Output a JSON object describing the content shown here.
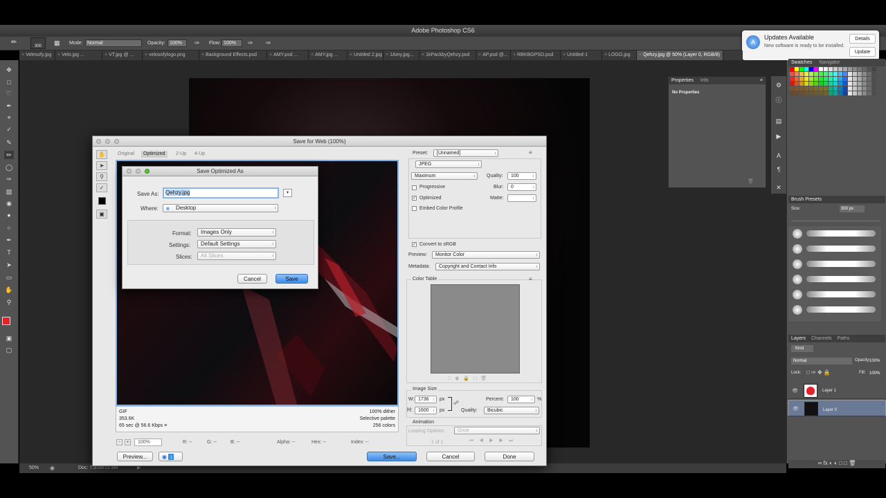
{
  "app": {
    "title": "Adobe Photoshop CS6"
  },
  "options_bar": {
    "brush_size": "300",
    "mode_label": "Mode:",
    "mode_value": "Normal",
    "opacity_label": "Opacity:",
    "opacity_value": "100%",
    "flow_label": "Flow:",
    "flow_value": "100%"
  },
  "doc_tabs": [
    "Velesofy.jpg",
    "Velo.jpg ...",
    "VT.jpg @ ...",
    "velosofylogo.png",
    "Background Effects.psd",
    "AMY.psd ...",
    "AMY.jpg ...",
    "Untitled 2.jpg",
    "1Amy.jpg...",
    "1kPackbyQehzy.psd",
    "AP.psd @...",
    "RBKBGPSD.psd",
    "Untitled-1",
    "LOGO.jpg",
    "Qehzy.jpg @ 50% (Layer 0, RGB/8)"
  ],
  "notification": {
    "title": "Updates Available",
    "body": "New software is ready to be installed.",
    "details_button": "Details",
    "update_button": "Update"
  },
  "properties_panel": {
    "tab_properties": "Properties",
    "tab_info": "Info",
    "content": "No Properties"
  },
  "swatches_panel": {
    "tab_swatches": "Swatches",
    "tab_navigator": "Navigator"
  },
  "brush_presets": {
    "title": "Brush Presets",
    "size_label": "Size:",
    "size_value": "300 px"
  },
  "layers_panel": {
    "tabs": [
      "Layers",
      "Channels",
      "Paths"
    ],
    "kind_label": "Kind",
    "blend_mode": "Normal",
    "opacity_label": "Opacity:",
    "opacity_value": "100%",
    "lock_label": "Lock:",
    "fill_label": "Fill:",
    "fill_value": "100%",
    "layers": [
      {
        "name": "Layer 1",
        "selected": false
      },
      {
        "name": "Layer 0",
        "selected": true
      }
    ]
  },
  "status_bar": {
    "zoom": "50%",
    "doc_info": "Doc: 7.91M/15.9M"
  },
  "save_for_web": {
    "title": "Save for Web (100%)",
    "view_tabs": [
      "Original",
      "Optimized",
      "2-Up",
      "4-Up"
    ],
    "active_tab": "Optimized",
    "preset_label": "Preset:",
    "preset_value": "[Unnamed]",
    "format_value": "JPEG",
    "compression_value": "Maximum",
    "quality_label": "Quality:",
    "quality_value": "100",
    "progressive_label": "Progressive",
    "progressive_checked": false,
    "blur_label": "Blur:",
    "blur_value": "0",
    "optimized_label": "Optimized",
    "optimized_checked": true,
    "matte_label": "Matte:",
    "embed_profile_label": "Embed Color Profile",
    "embed_profile_checked": false,
    "convert_srgb_label": "Convert to sRGB",
    "convert_srgb_checked": true,
    "preview_label": "Preview:",
    "preview_value": "Monitor Color",
    "metadata_label": "Metadata:",
    "metadata_value": "Copyright and Contact Info",
    "color_table_label": "Color Table",
    "image_size_label": "Image Size",
    "width_label": "W:",
    "width_value": "1736",
    "height_label": "H:",
    "height_value": "1600",
    "px_unit": "px",
    "percent_label": "Percent:",
    "percent_value": "100",
    "percent_unit": "%",
    "resample_quality_label": "Quality:",
    "resample_quality_value": "Bicubic",
    "animation_label": "Animation",
    "looping_label": "Looping Options:",
    "looping_value": "Once",
    "frame_counter": "1 of 1",
    "info_left": [
      "GIF",
      "353.6K",
      "65 sec @ 56.6 Kbps"
    ],
    "info_right": [
      "100% dither",
      "Selective palette",
      "256 colors"
    ],
    "zoom_value": "100%",
    "readouts": {
      "r": "R: --",
      "g": "G: --",
      "b": "B: --",
      "alpha": "Alpha: --",
      "hex": "Hex: --",
      "index": "Index: --"
    },
    "preview_button": "Preview...",
    "save_button": "Save...",
    "cancel_button": "Cancel",
    "done_button": "Done"
  },
  "save_sheet": {
    "title": "Save Optimized As",
    "save_as_label": "Save As:",
    "filename": "Qehzy.jpg",
    "where_label": "Where:",
    "where_value": "Desktop",
    "format_label": "Format:",
    "format_value": "Images Only",
    "settings_label": "Settings:",
    "settings_value": "Default Settings",
    "slices_label": "Slices:",
    "slices_value": "All Slices",
    "cancel_button": "Cancel",
    "save_button": "Save"
  },
  "colors": {
    "foreground": "#e8202a",
    "background": "#ffffff",
    "accent": "#3d8ae6"
  }
}
